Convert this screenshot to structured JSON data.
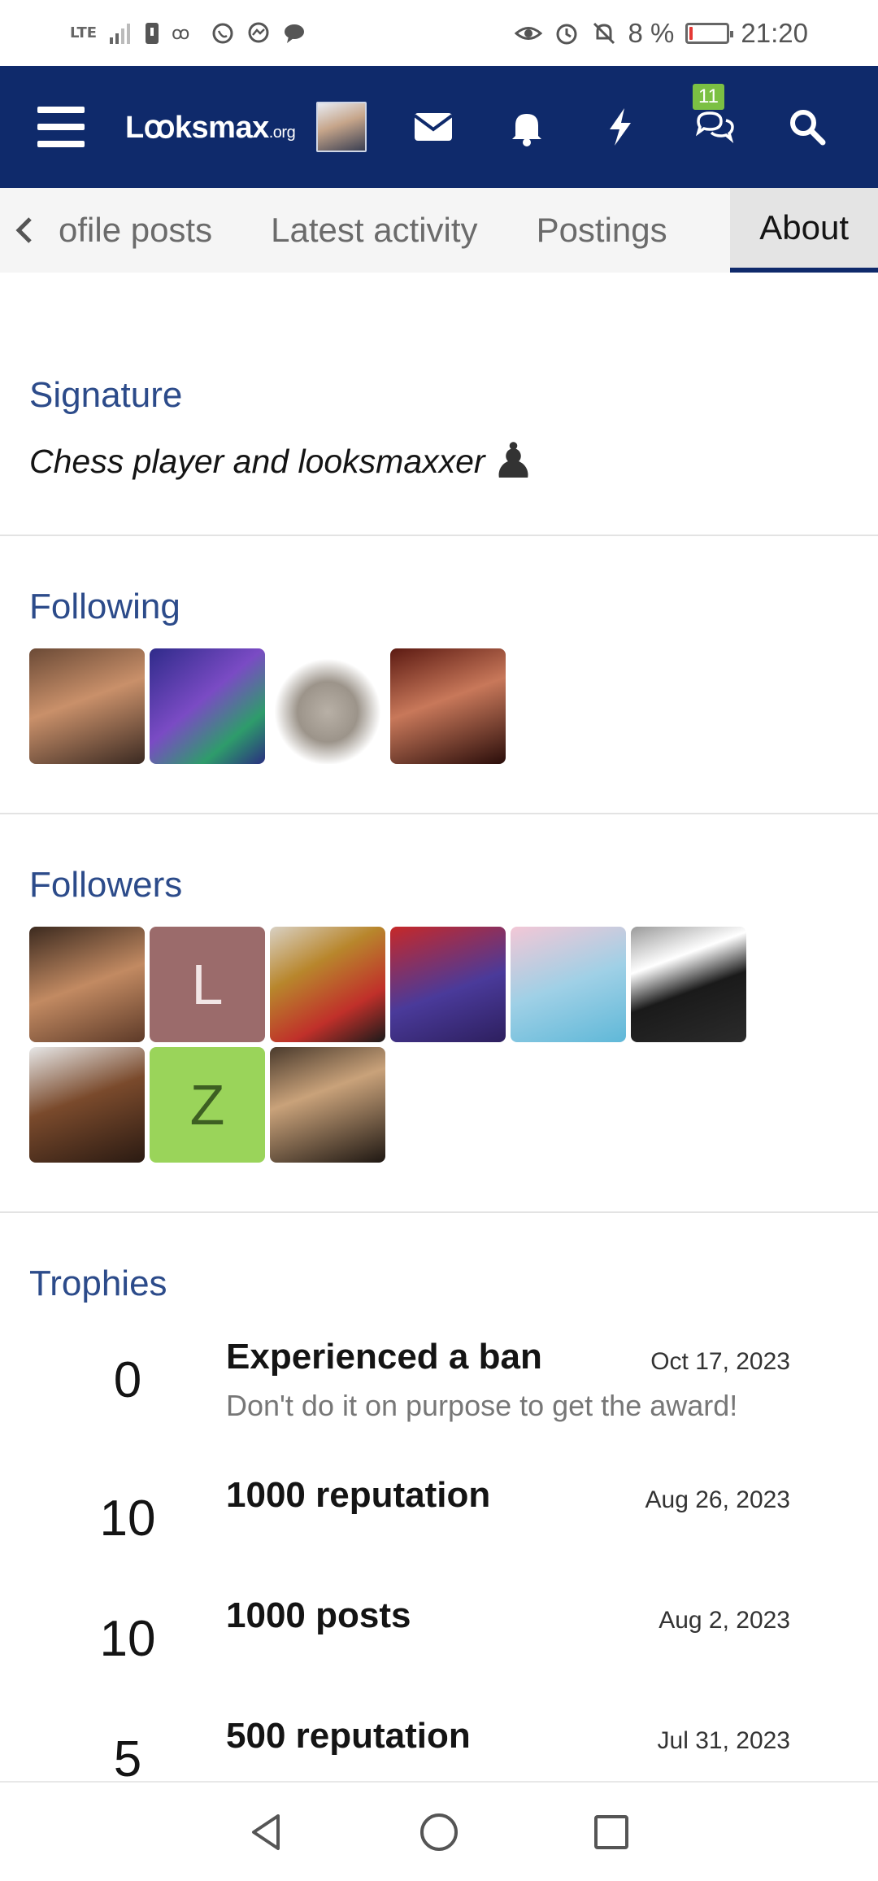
{
  "status_bar": {
    "network_label": "LTE",
    "battery_text": "8 %",
    "battery_level": 0.08,
    "time": "21:20",
    "icons": [
      "signal-icon",
      "sim-icon",
      "voicemail-icon",
      "whatsapp-icon",
      "messenger-icon",
      "chat-icon",
      "eye-icon",
      "alarm-icon",
      "mute-bell-icon",
      "battery-icon"
    ]
  },
  "topbar": {
    "logo_main": "Lꝏksmax",
    "logo_suffix": ".org",
    "conversations_badge": "11",
    "bg_color": "#0f2a6b"
  },
  "tabs": {
    "items": [
      {
        "label": "ofile posts"
      },
      {
        "label": "Latest activity"
      },
      {
        "label": "Postings"
      },
      {
        "label": "About"
      }
    ],
    "active_index": 3
  },
  "signature": {
    "title": "Signature",
    "text": "Chess player and looksmaxxer",
    "emoji": "♟"
  },
  "following": {
    "title": "Following",
    "avatars": [
      {
        "letter": "",
        "bg": "linear-gradient(160deg,#6b4a36 0%,#c9906a 45%,#3b2a22 100%)"
      },
      {
        "letter": "",
        "bg": "linear-gradient(140deg,#2f2b8a 0%,#7a4bc4 45%,#2e9c6b 75%,#2a2f80 100%)"
      },
      {
        "letter": "",
        "bg": "radial-gradient(circle at 50% 55%,#b8b0a6 0%,#9c948a 35%,#ffffff 62%)"
      },
      {
        "letter": "",
        "bg": "linear-gradient(160deg,#5c1a12 0%,#c8785a 45%,#2a0d0a 100%)"
      }
    ]
  },
  "followers": {
    "title": "Followers",
    "avatars": [
      {
        "letter": "",
        "bg": "linear-gradient(160deg,#3c2a1f 0%,#c28a62 50%,#5d3a28 100%)"
      },
      {
        "letter": "L",
        "bg": "#9b6b6b"
      },
      {
        "letter": "",
        "bg": "linear-gradient(150deg,#d9d1c4 0%,#b8862c 35%,#c0302a 70%,#1a1a1a 100%)"
      },
      {
        "letter": "",
        "bg": "linear-gradient(160deg,#c62828 0%,#4a3a9a 55%,#2d1f5e 100%)"
      },
      {
        "letter": "",
        "bg": "linear-gradient(160deg,#f3c7d6 0%,#9fd0e6 50%,#5fb8d8 100%)"
      },
      {
        "letter": "",
        "bg": "linear-gradient(160deg,#9a9a9a 0%,#ffffff 30%,#1a1a1a 55%,#2b2b2b 100%)"
      },
      {
        "letter": "",
        "bg": "linear-gradient(160deg,#e7e7e7 0%,#7a4a2c 45%,#2a1a12 100%)"
      },
      {
        "letter": "Z",
        "bg": "#9ad45a"
      },
      {
        "letter": "",
        "bg": "linear-gradient(160deg,#4a3a2c 0%,#c9a27a 40%,#1e1712 100%)"
      }
    ]
  },
  "trophies": {
    "title": "Trophies",
    "items": [
      {
        "points": "0",
        "name": "Experienced a ban",
        "desc": "Don't do it on purpose to get the award!",
        "date": "Oct 17, 2023"
      },
      {
        "points": "10",
        "name": "1000 reputation",
        "desc": "",
        "date": "Aug 26, 2023"
      },
      {
        "points": "10",
        "name": "1000 posts",
        "desc": "",
        "date": "Aug 2, 2023"
      },
      {
        "points": "5",
        "name": "500 reputation",
        "desc": "",
        "date": "Jul 31, 2023"
      }
    ]
  },
  "system_nav": {
    "icons": [
      "back-icon",
      "home-icon",
      "recents-icon"
    ]
  }
}
